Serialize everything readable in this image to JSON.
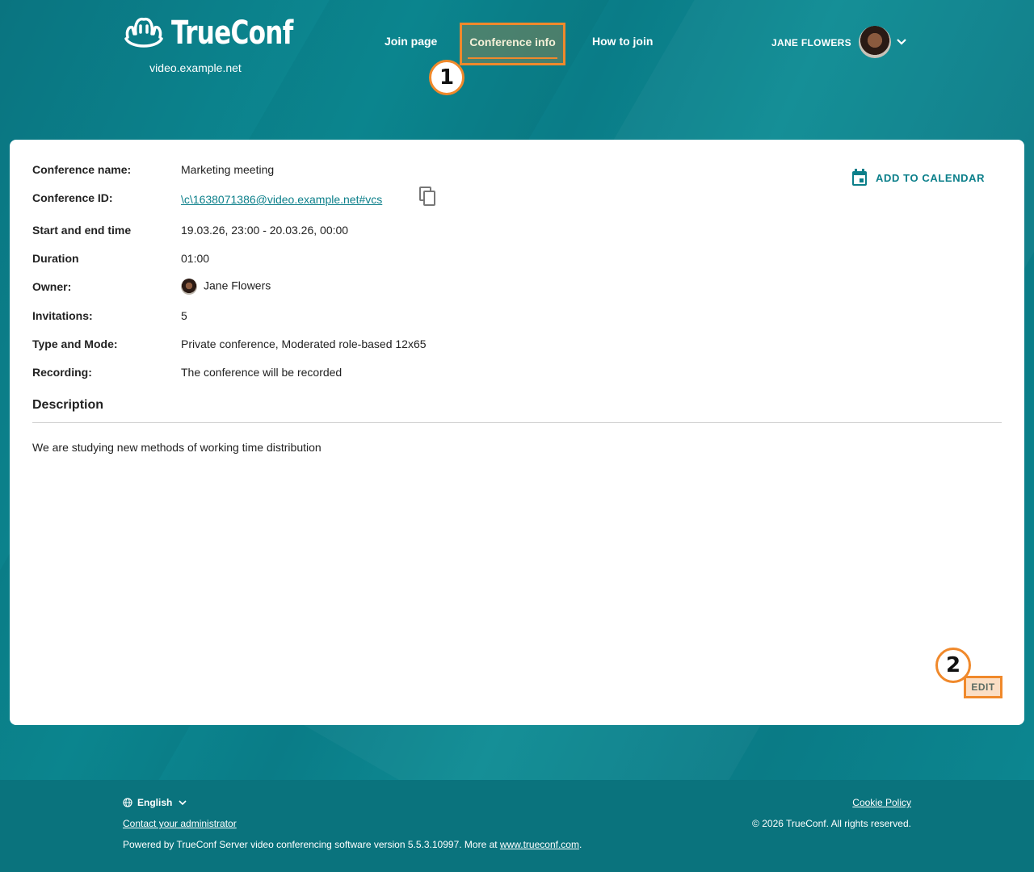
{
  "header": {
    "logo_text": "TrueConf",
    "server_name": "video.example.net",
    "nav": {
      "join_page": "Join page",
      "conference_info": "Conference info",
      "how_to_join": "How to join"
    },
    "user_name": "JANE FLOWERS"
  },
  "annotations": {
    "badge1": "1",
    "badge2": "2"
  },
  "conference": {
    "name_label": "Conference name:",
    "name_value": "Marketing meeting",
    "id_label": "Conference ID:",
    "id_value": "\\c\\1638071386@video.example.net#vcs",
    "time_label": "Start and end time",
    "time_value": "19.03.26, 23:00 - 20.03.26, 00:00",
    "duration_label": "Duration",
    "duration_value": "01:00",
    "owner_label": "Owner:",
    "owner_value": "Jane Flowers",
    "invitations_label": "Invitations:",
    "invitations_value": "5",
    "type_label": "Type and Mode:",
    "type_value": "Private conference, Moderated role-based 12x65",
    "recording_label": "Recording:",
    "recording_value": "The conference will be recorded",
    "add_to_calendar": "ADD TO CALENDAR",
    "description_title": "Description",
    "description_text": "We are studying new methods of working time distribution",
    "edit_label": "EDIT"
  },
  "footer": {
    "language": "English",
    "contact": "Contact your administrator",
    "powered_prefix": "Powered by TrueConf Server video conferencing software version 5.5.3.10997. More at ",
    "powered_link": "www.trueconf.com",
    "powered_suffix": ".",
    "cookie": "Cookie Policy",
    "copyright": "© 2026 TrueConf. All rights reserved."
  },
  "colors": {
    "accent": "#0b7f8a",
    "highlight": "#f0892b",
    "background": "#0b7f8a"
  }
}
